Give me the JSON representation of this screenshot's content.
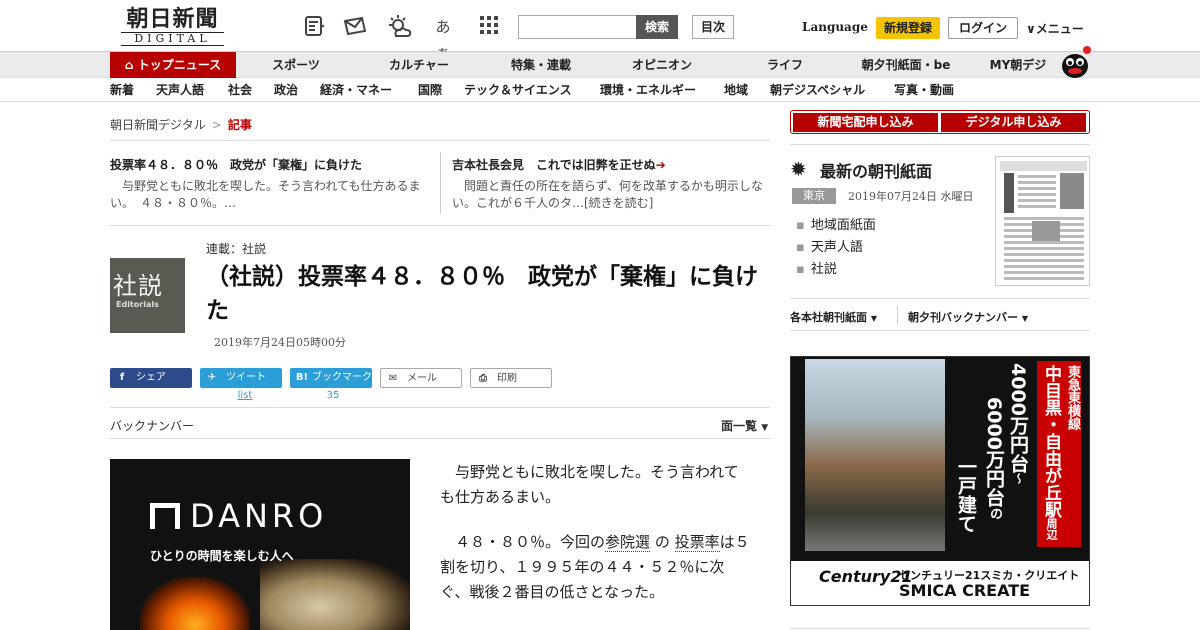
{
  "header": {
    "logo_main": "朝日新聞",
    "logo_sub": "DIGITAL",
    "search_button": "検索",
    "mokuji": "目次",
    "language": "Language",
    "register": "新規登録",
    "login": "ログイン",
    "menu": "メニュー",
    "font_size_icon_text": "あぁ"
  },
  "nav_primary": [
    {
      "label": "トップニュース",
      "active": true
    },
    {
      "label": "スポーツ"
    },
    {
      "label": "カルチャー"
    },
    {
      "label": "特集・連載"
    },
    {
      "label": "オピニオン"
    },
    {
      "label": "ライフ"
    },
    {
      "label": "朝夕刊紙面・be"
    },
    {
      "label": "MY朝デジ"
    }
  ],
  "nav_secondary": [
    "新着",
    "天声人語",
    "社会",
    "政治",
    "経済・マネー",
    "国際",
    "テック＆サイエンス",
    "環境・エネルギー",
    "地域",
    "朝デジスペシャル",
    "写真・動画"
  ],
  "breadcrumb": {
    "home": "朝日新聞デジタル",
    "sep": ">",
    "current": "記事"
  },
  "related": [
    {
      "title": "投票率４８．８０％　政党が「棄権」に負けた",
      "text": "与野党ともに敗北を喫した。そう言われても仕方あるまい。　４８・８０％。…"
    },
    {
      "title": "吉本社長会見　これでは旧弊を正せぬ",
      "text": "問題と責任の所在を語らず、何を改革するかも明示しない。これが６千人のタ…[続きを読む]"
    }
  ],
  "article": {
    "thumb_kanji": "社説",
    "thumb_en": "Editorials",
    "series": "連載：社説",
    "headline": "（社説）投票率４８．８０％　政党が「棄権」に負けた",
    "date": "2019年7月24日05時00分"
  },
  "share": {
    "facebook": "シェア",
    "twitter": "ツイート",
    "hatena": "ブックマーク",
    "mail": "メール",
    "print": "印刷",
    "twitter_count": "list",
    "hatena_count": "35"
  },
  "backnumber": "バックナンバー",
  "menlist": "面一覧",
  "ad_danro": {
    "logo": "DANRO",
    "tagline": "ひとりの時間を楽しむ人へ"
  },
  "body": {
    "p1": "与野党ともに敗北を喫した。そう言われても仕方あるまい。",
    "p2_a": "４８・８０％。今回の",
    "p2_kw1": "参院選",
    "p2_b": "の",
    "p2_kw2": "投票率",
    "p2_c": "は５割を切り、１９９５年の４４・５２％に次ぐ、戦後２番目の低さとなった。"
  },
  "right": {
    "sub_home": "新聞宅配申し込み",
    "sub_digital": "デジタル申し込み",
    "latest_title": "最新の朝刊紙面",
    "edition": "東京",
    "edition_date": "2019年07月24日 水曜日",
    "links": [
      "地域面紙面",
      "天声人語",
      "社説"
    ],
    "dropdown1": "各本社朝刊紙面",
    "dropdown2": "朝夕刊バックナンバー"
  },
  "ad_right": {
    "line1": "東急東横線",
    "line2": "中目黒・自由が丘駅",
    "line2_small": "周辺",
    "line3": "4000万円台",
    "line3_tilde": "〜",
    "line4": "6000万円台",
    "line4_no": "の",
    "line5": "一戸建て",
    "brand1": "Century21",
    "brand2": "センチュリー21スミカ・クリエイト",
    "brand3": "SMICA CREATE"
  }
}
